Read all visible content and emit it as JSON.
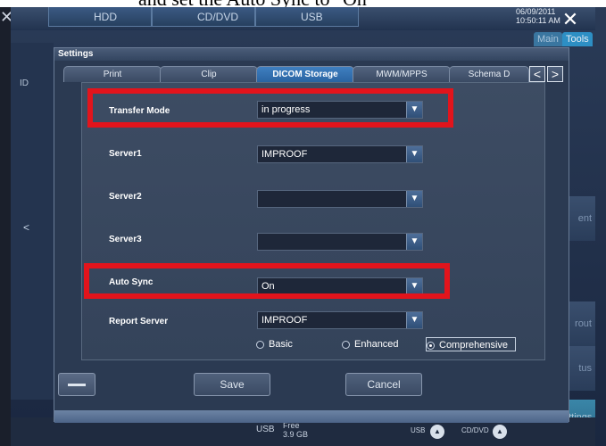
{
  "caption": {
    "text": "and set the Auto Sync to \"On\""
  },
  "device": {
    "top_tabs": [
      "HDD",
      "CD/DVD",
      "USB"
    ],
    "date": "06/09/2011",
    "time": "10:50:11 AM",
    "nav_tabs": [
      "Main",
      "Tools"
    ],
    "left_panel": {
      "header": "ID"
    },
    "right_buttons": [
      "ent",
      "rout",
      "tus"
    ],
    "settings_button": "Settings",
    "status": {
      "usb": "USB",
      "free_label": "Free",
      "free_value": "3.9 GB",
      "usb2": "USB",
      "cddvd": "CD/DVD"
    }
  },
  "dialog": {
    "title": "Settings",
    "tabs": [
      "Print",
      "Clip",
      "DICOM Storage",
      "MWM/MPPS",
      "Schema D"
    ],
    "active_tab": "DICOM Storage",
    "fields": {
      "transfer_mode": {
        "label": "Transfer Mode",
        "value": "in progress"
      },
      "server1": {
        "label": "Server1",
        "value": "IMPROOF"
      },
      "server2": {
        "label": "Server2",
        "value": ""
      },
      "server3": {
        "label": "Server3",
        "value": ""
      },
      "auto_sync": {
        "label": "Auto Sync",
        "value": "On"
      },
      "report_server": {
        "label": "Report Server",
        "value": "IMPROOF"
      }
    },
    "report_options": [
      "Basic",
      "Enhanced",
      "Comprehensive"
    ],
    "selected_report_option": "Comprehensive",
    "buttons": {
      "save": "Save",
      "cancel": "Cancel"
    }
  },
  "colors": {
    "highlight": "#e2141c",
    "active_tab": "#2a64a2",
    "dialog_bg": "#2b3a52"
  },
  "icons": {
    "dropdown": "chevron-down-icon",
    "keyboard": "keyboard-icon",
    "tab_prev": "chevron-left-icon",
    "tab_next": "chevron-right-icon"
  }
}
